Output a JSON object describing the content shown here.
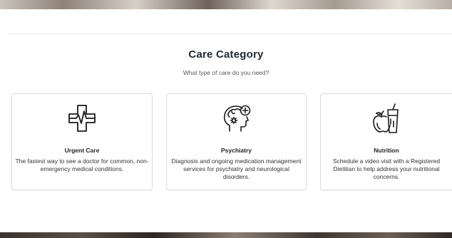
{
  "section": {
    "title": "Care Category",
    "subtitle": "What type of care do you need?"
  },
  "cards": [
    {
      "icon": "medical-cross-heartbeat-icon",
      "title": "Urgent Care",
      "description": "The fastest way to see a doctor for common, non-emergency medical conditions."
    },
    {
      "icon": "head-brain-gear-icon",
      "title": "Psychiatry",
      "description": "Diagnosis and ongoing medication management services for psychiatry and neurological disorders."
    },
    {
      "icon": "apple-juice-glass-icon",
      "title": "Nutrition",
      "description": "Schedule a video visit with a Registered Dietitian to help address your nutritional concerns."
    }
  ]
}
